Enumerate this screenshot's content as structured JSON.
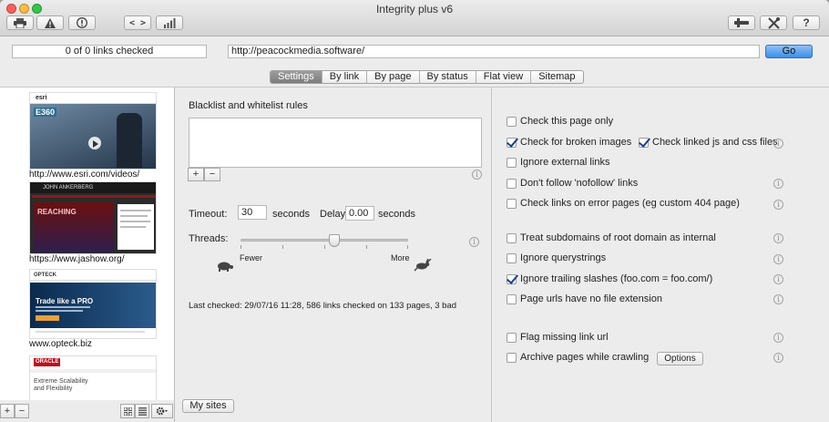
{
  "window": {
    "title": "Integrity plus v6"
  },
  "toolbar": {
    "print_icon": "printer-icon",
    "warning_icon": "warning-icon",
    "stop_icon": "stop-icon",
    "code_label": "< >",
    "stats_icon": "bar-chart-icon",
    "tools_icon": "tools-icon",
    "settings_icon": "wrench-screwdriver-icon",
    "help_label": "?"
  },
  "url_row": {
    "status": "0 of 0 links checked",
    "url": "http://peacockmedia.software/",
    "go_label": "Go"
  },
  "tabs": [
    {
      "label": "Settings",
      "active": true
    },
    {
      "label": "By link"
    },
    {
      "label": "By page"
    },
    {
      "label": "By status"
    },
    {
      "label": "Flat view"
    },
    {
      "label": "Sitemap"
    }
  ],
  "sidebar": {
    "thumbnails": [
      {
        "caption": "http://www.esri.com/videos/",
        "brand": "esri",
        "banner": "E360"
      },
      {
        "caption": "https://www.jashow.org/",
        "brand": "JOHN ANKERBERG",
        "banner": "REACHING"
      },
      {
        "caption": "www.opteck.biz",
        "brand": "OPTECK",
        "banner": "Trade like a PRO"
      },
      {
        "caption": "",
        "brand": "ORACLE",
        "banner": "Extreme Scalability and Flexibility"
      }
    ],
    "add_label": "+",
    "remove_label": "−",
    "grid_icon": "grid-view-icon",
    "list_icon": "list-view-icon",
    "gear_icon": "gear-icon"
  },
  "settings": {
    "blacklist_title": "Blacklist and whitelist rules",
    "add_rule_label": "+",
    "remove_rule_label": "−",
    "timeout_label": "Timeout:",
    "timeout_value": "30",
    "timeout_unit": "seconds",
    "delay_label": "Delay:",
    "delay_value": "0.00",
    "delay_unit": "seconds",
    "threads_label": "Threads:",
    "threads_level": 0.56,
    "fewer_label": "Fewer",
    "more_label": "More",
    "last_checked": "Last checked: 29/07/16 11:28, 586 links checked on 133 pages, 3 bad",
    "mysites_label": "My sites"
  },
  "options": [
    {
      "label": "Check this page only",
      "checked": false
    },
    {
      "label": "Check for broken images",
      "checked": true
    },
    {
      "label": "Check linked js and css files",
      "checked": true
    },
    {
      "label": "Ignore external links",
      "checked": false
    },
    {
      "label": "Don't follow 'nofollow' links",
      "checked": false
    },
    {
      "label": "Check links on error pages (eg custom 404 page)",
      "checked": false
    },
    {
      "label": "Treat subdomains of root domain as internal",
      "checked": false
    },
    {
      "label": "Ignore querystrings",
      "checked": false
    },
    {
      "label": "Ignore trailing slashes (foo.com = foo.com/)",
      "checked": true
    },
    {
      "label": "Page urls have no file extension",
      "checked": false
    },
    {
      "label": "Flag missing link url",
      "checked": false
    },
    {
      "label": "Archive pages while crawling",
      "checked": false
    }
  ],
  "options_button_label": "Options",
  "info_glyph": "i"
}
